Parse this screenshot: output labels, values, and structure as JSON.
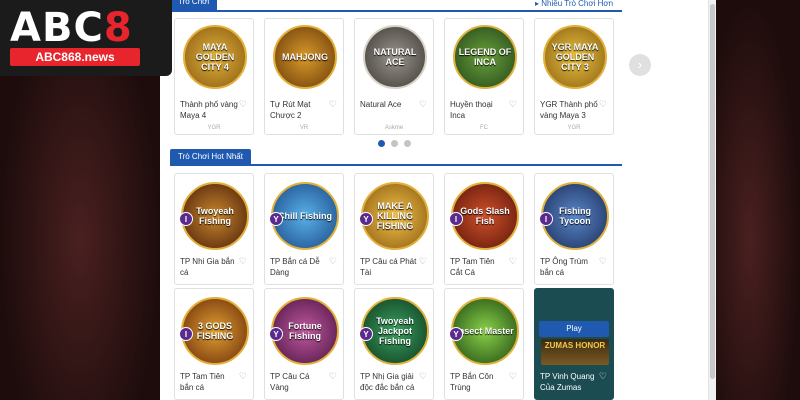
{
  "logo": {
    "title_abc": "ABC",
    "title_8": "8",
    "subtitle": "ABC868.news"
  },
  "top_section": {
    "tab_label": "Trò Chơi",
    "more_link": "Nhiều Trò Chơi Hơn"
  },
  "hot_section": {
    "tab_label": "Trò Chơi Hot Nhất"
  },
  "top_row": [
    {
      "name": "Thành phố vàng Maya 4",
      "vendor": "YGR",
      "art": "MAYA GOLDEN CITY 4",
      "color": "#c2891b"
    },
    {
      "name": "Tự Rút Mạt Chược 2",
      "vendor": "VR",
      "art": "MAHJONG",
      "color": "#a86612"
    },
    {
      "name": "Natural Ace",
      "vendor": "Askme",
      "art": "NATURAL ACE",
      "color": "#6f6a64"
    },
    {
      "name": "Huyền thoại Inca",
      "vendor": "FC",
      "art": "LEGEND OF INCA",
      "color": "#3b6b2a"
    },
    {
      "name": "YGR Thành phố vàng Maya 3",
      "vendor": "YGR",
      "art": "YGR MAYA GOLDEN CITY 3",
      "color": "#b58317"
    }
  ],
  "hot_row_1": [
    {
      "name": "TP Nhi Gia bắn cá",
      "badge": "I",
      "art": "Twoyeah Fishing",
      "color": "#7a3a1a"
    },
    {
      "name": "TP Bắn cá Dễ Dàng",
      "badge": "Y",
      "art": "Chill Fishing",
      "color": "#2a7ac2"
    },
    {
      "name": "TP Câu cá Phát Tài",
      "badge": "Y",
      "art": "MAKE A KILLING FISHING",
      "color": "#b0781c"
    },
    {
      "name": "TP Tam Tiên Cắt Cá",
      "badge": "I",
      "art": "Gods Slash Fish",
      "color": "#8c2418"
    },
    {
      "name": "TP Ông Trùm bắn cá",
      "badge": "I",
      "art": "Fishing Tycoon",
      "color": "#2c4f86"
    }
  ],
  "hot_row_2": [
    {
      "name": "TP Tam Tiên bắn cá",
      "badge": "I",
      "art": "3 GODS FISHING",
      "color": "#b06a16"
    },
    {
      "name": "TP Câu Cá Vàng",
      "badge": "Y",
      "art": "Fortune Fishing",
      "color": "#8c3a72"
    },
    {
      "name": "TP Nhị Gia giải độc đắc bắn cá",
      "badge": "Y",
      "art": "Twoyeah Jackpot Fishing",
      "color": "#1e6a3a"
    },
    {
      "name": "TP Bắn Côn Trùng",
      "badge": "Y",
      "art": "Insect Master",
      "color": "#3c8a24"
    },
    {
      "name": "TP Vinh Quang Của Zumas",
      "badge": "",
      "art": "ZUMAS HONOR",
      "color": "#1a4c52",
      "play": "Play"
    }
  ],
  "icons": {
    "fav": "heart-icon",
    "prev": "chevron-left-icon",
    "next": "chevron-right-icon"
  }
}
